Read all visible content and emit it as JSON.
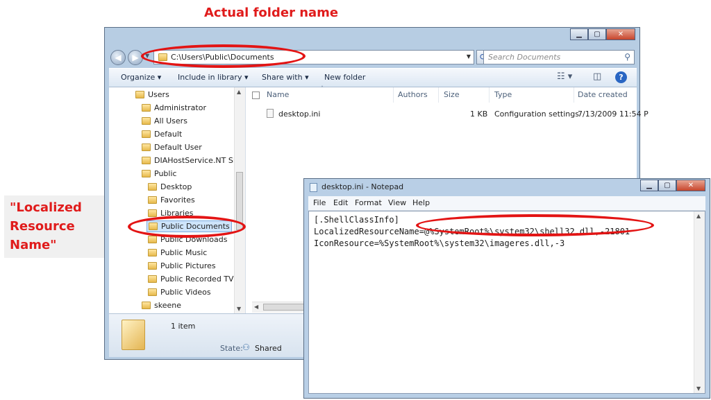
{
  "annotations": {
    "folder_title": "Actual folder name",
    "localized_line1": "\"Localized",
    "localized_line2": "Resource",
    "localized_line3": "Name\""
  },
  "explorer": {
    "address": "C:\\Users\\Public\\Documents",
    "search_placeholder": "Search Documents",
    "toolbar": {
      "organize": "Organize ▾",
      "include": "Include in library ▾",
      "share": "Share with ▾",
      "new_folder": "New folder"
    },
    "tree": [
      {
        "label": "Users"
      },
      {
        "label": "Administrator"
      },
      {
        "label": "All Users"
      },
      {
        "label": "Default"
      },
      {
        "label": "Default User"
      },
      {
        "label": "DIAHostService.NT SERV"
      },
      {
        "label": "Public"
      },
      {
        "label": "Desktop"
      },
      {
        "label": "Favorites"
      },
      {
        "label": "Libraries"
      },
      {
        "label": "Public Documents"
      },
      {
        "label": "Public Downloads"
      },
      {
        "label": "Public Music"
      },
      {
        "label": "Public Pictures"
      },
      {
        "label": "Public Recorded TV"
      },
      {
        "label": "Public Videos"
      },
      {
        "label": "skeene"
      }
    ],
    "columns": {
      "name": "Name",
      "authors": "Authors",
      "size": "Size",
      "type": "Type",
      "date": "Date created"
    },
    "files": [
      {
        "name": "desktop.ini",
        "size": "1 KB",
        "type": "Configuration settings",
        "date": "7/13/2009 11:54 P"
      }
    ],
    "details": {
      "count": "1 item",
      "state_label": "State:",
      "state_value": "Shared"
    }
  },
  "notepad": {
    "title": "desktop.ini - Notepad",
    "menu": [
      "File",
      "Edit",
      "Format",
      "View",
      "Help"
    ],
    "lines": [
      "[.ShellClassInfo]",
      "LocalizedResourceName=@%SystemRoot%\\system32\\shell32.dll,-21801",
      "IconResource=%SystemRoot%\\system32\\imageres.dll,-3"
    ]
  }
}
